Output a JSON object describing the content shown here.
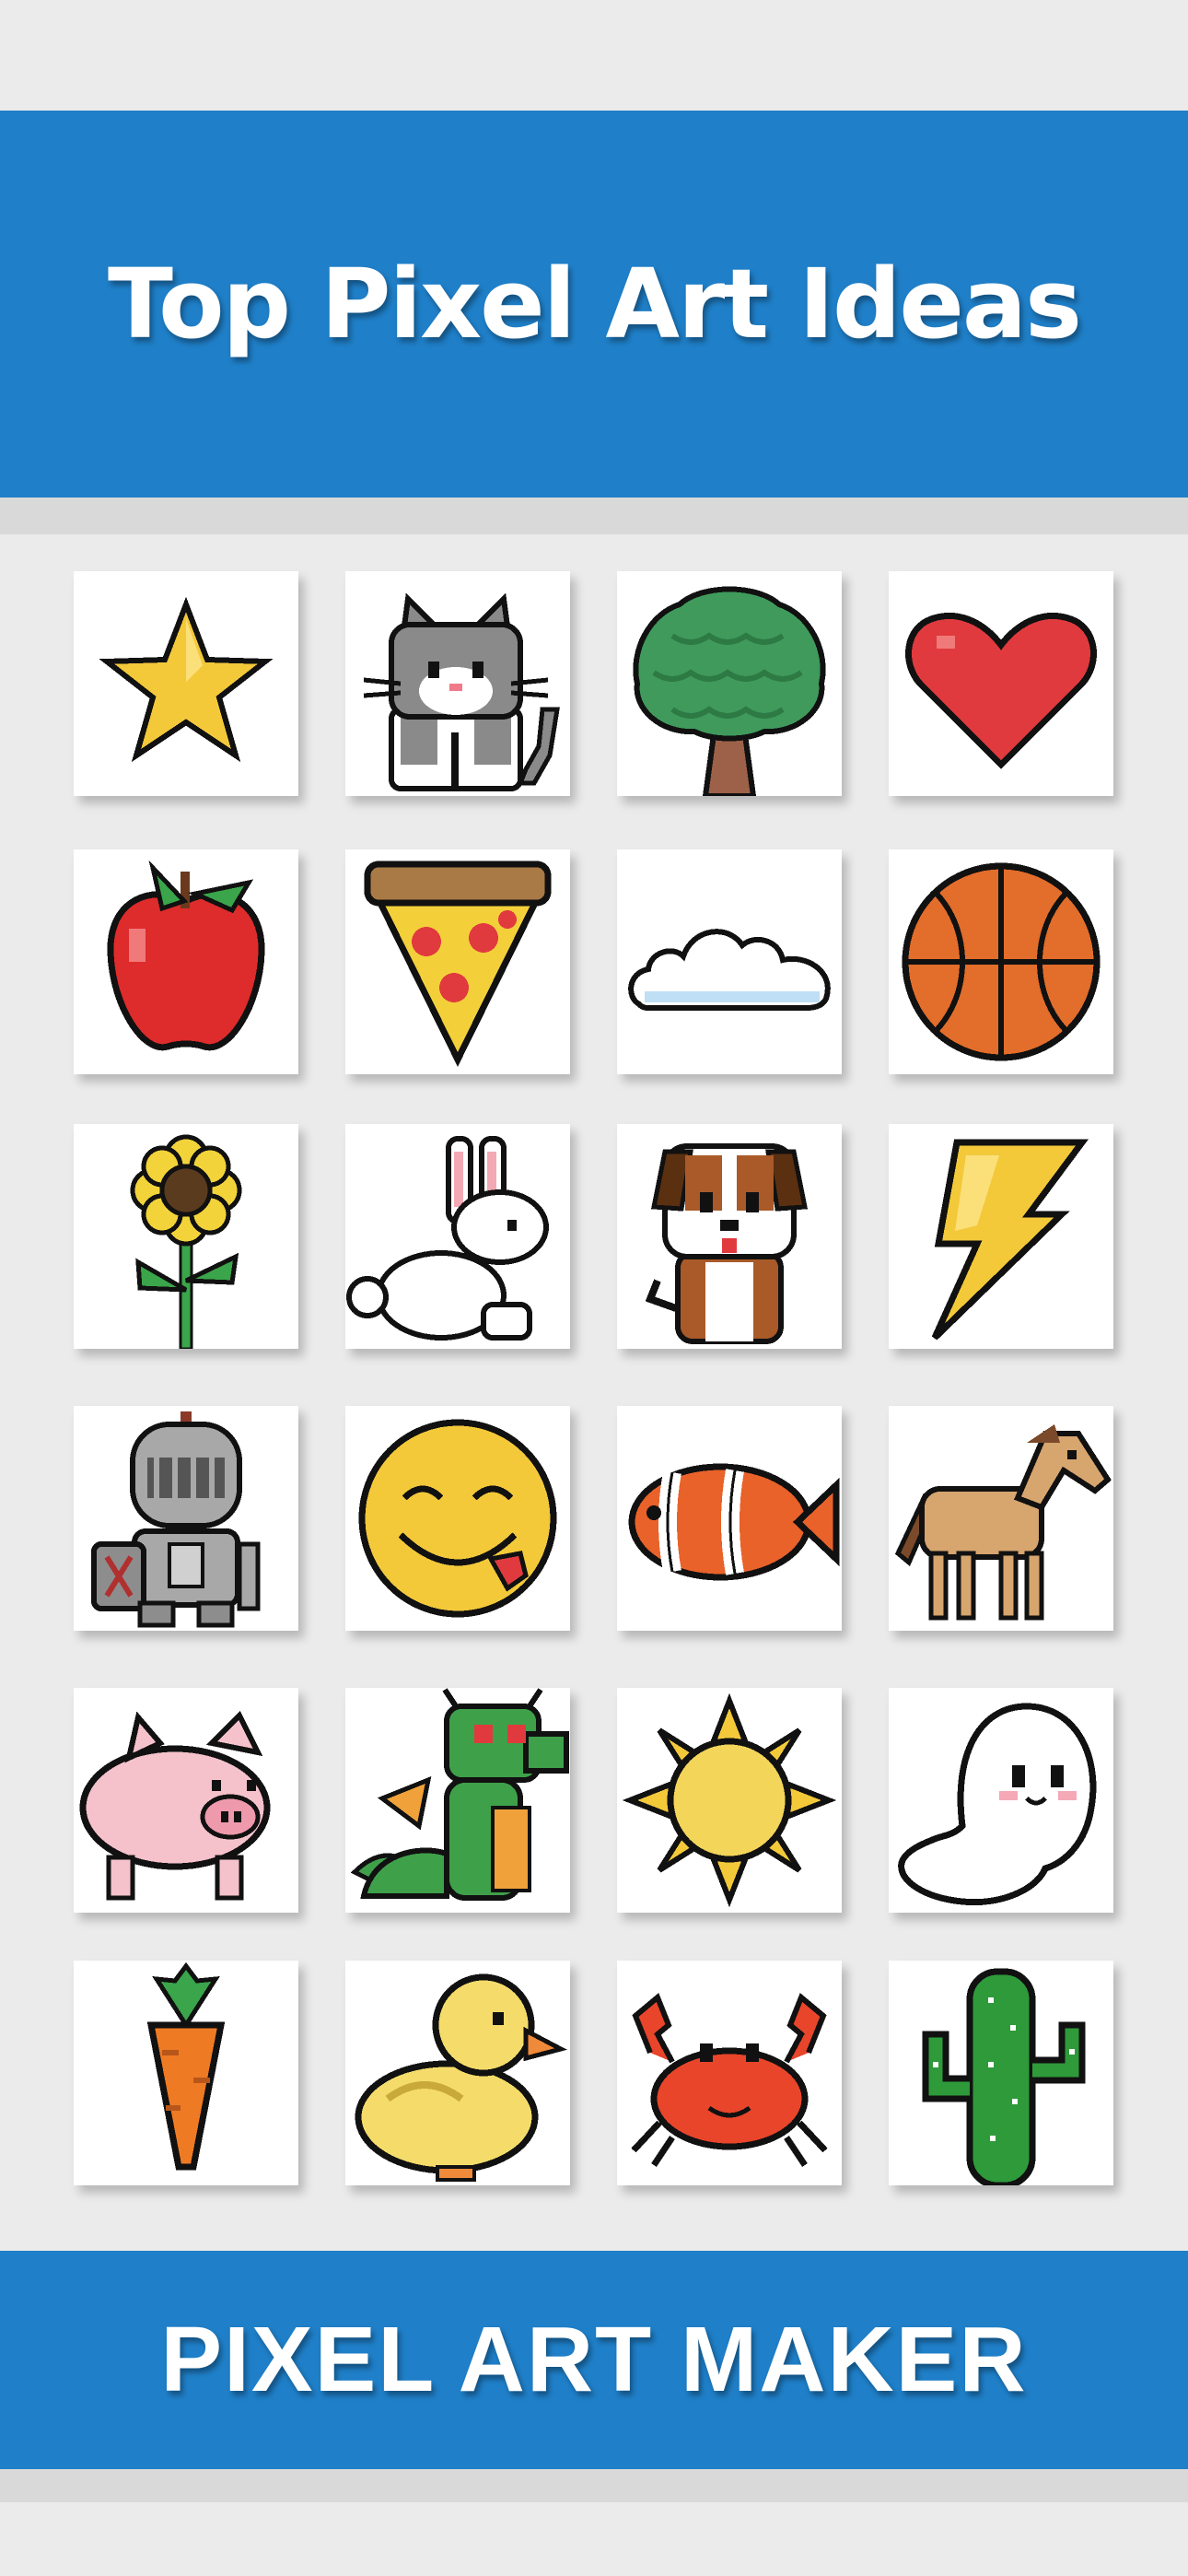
{
  "header": {
    "title": "Top Pixel Art Ideas"
  },
  "footer": {
    "title": "PIXEL ART MAKER"
  },
  "grid": {
    "tiles": [
      {
        "icon": "star-icon"
      },
      {
        "icon": "cat-icon"
      },
      {
        "icon": "tree-icon"
      },
      {
        "icon": "heart-icon"
      },
      {
        "icon": "apple-icon"
      },
      {
        "icon": "pizza-slice-icon"
      },
      {
        "icon": "cloud-icon"
      },
      {
        "icon": "basketball-icon"
      },
      {
        "icon": "sunflower-icon"
      },
      {
        "icon": "rabbit-icon"
      },
      {
        "icon": "puppy-icon"
      },
      {
        "icon": "lightning-bolt-icon"
      },
      {
        "icon": "knight-icon"
      },
      {
        "icon": "yummy-emoji-icon"
      },
      {
        "icon": "clownfish-icon"
      },
      {
        "icon": "horse-icon"
      },
      {
        "icon": "pig-icon"
      },
      {
        "icon": "dragon-icon"
      },
      {
        "icon": "sun-icon"
      },
      {
        "icon": "ghost-icon"
      },
      {
        "icon": "carrot-icon"
      },
      {
        "icon": "duck-icon"
      },
      {
        "icon": "crab-icon"
      },
      {
        "icon": "cactus-icon"
      }
    ]
  },
  "colors": {
    "banner": "#1f7fc8",
    "background": "#ebebeb",
    "tile": "#ffffff"
  }
}
